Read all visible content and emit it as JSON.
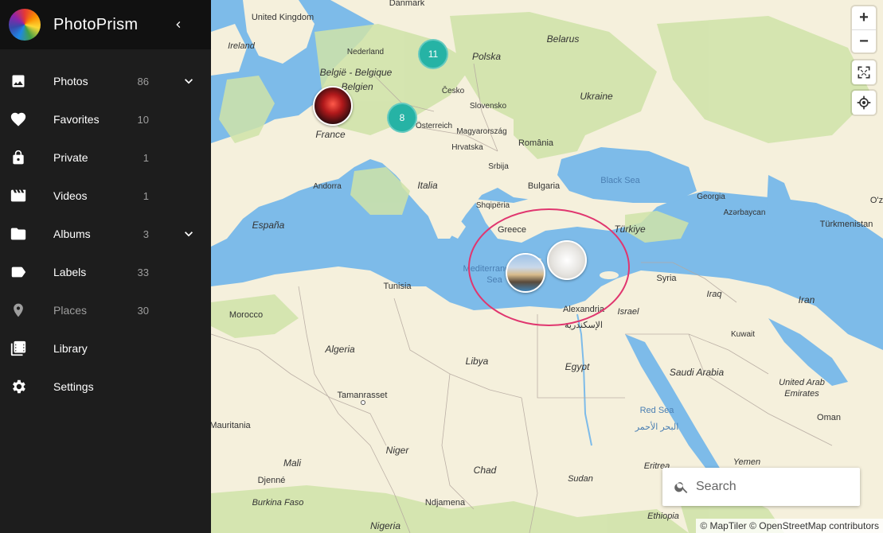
{
  "app": {
    "title": "PhotoPrism"
  },
  "sidebar": {
    "items": [
      {
        "label": "Photos",
        "count": "86"
      },
      {
        "label": "Favorites",
        "count": "10"
      },
      {
        "label": "Private",
        "count": "1"
      },
      {
        "label": "Videos",
        "count": "1"
      },
      {
        "label": "Albums",
        "count": "3"
      },
      {
        "label": "Labels",
        "count": "33"
      },
      {
        "label": "Places",
        "count": "30"
      },
      {
        "label": "Library",
        "count": ""
      },
      {
        "label": "Settings",
        "count": ""
      }
    ]
  },
  "map": {
    "labels": {
      "united_kingdom": "United Kingdom",
      "ireland": "Ireland",
      "danmark": "Danmark",
      "nederland": "Nederland",
      "belgie": "België - Belgique",
      "belgien": "- Belgien",
      "france": "France",
      "polska": "Polska",
      "belarus": "Belarus",
      "cesko": "Česko",
      "slovensko": "Slovensko",
      "osterreich": "Österreich",
      "ukraine": "Ukraine",
      "romania": "România",
      "magyarorszag": "Magyarország",
      "hrvatska": "Hrvatska",
      "srbija": "Srbija",
      "bulgaria": "Bulgaria",
      "shqiperia": "Shqipëria",
      "italia": "Italia",
      "andorra": "Andorra",
      "espana": "España",
      "black_sea": "Black Sea",
      "georgia": "Georgia",
      "azarbaycan": "Azərbaycan",
      "turkiye": "Türkiye",
      "turkmenistan": "Türkmenistan",
      "oz": "O'z",
      "ellada": "Greece",
      "mediterranean": "Mediterranean",
      "sea": "Sea",
      "syria": "Syria",
      "iraq": "Iraq",
      "iran": "Iran",
      "israel": "Israel",
      "alexandria": "Alexandria",
      "alexandria_ar": "الإسكندرية",
      "tunisia": "Tunisia",
      "morocco": "Morocco",
      "algeria": "Algeria",
      "libya": "Libya",
      "egypt": "Egypt",
      "kuwait": "Kuwait",
      "saudi_arabia": "Saudi Arabia",
      "uae": "United Arab",
      "emirates": "Emirates",
      "tamanrasset": "Tamanrasset",
      "mauritania": "Mauritania",
      "red_sea": "Red Sea",
      "red_sea_ar": "البحر الأحمر",
      "oman": "Oman",
      "mali": "Mali",
      "niger": "Niger",
      "chad": "Chad",
      "sudan": "Sudan",
      "eritrea": "Eritrea",
      "yemen": "Yemen",
      "djenne": "Djenné",
      "burkina": "Burkina Faso",
      "ndjamena": "Ndjamena",
      "nigeria": "Nigeria",
      "ethiopia": "Ethiopia"
    },
    "clusters": [
      "11",
      "8"
    ],
    "zoom_in": "+",
    "zoom_out": "−",
    "search_placeholder": "Search",
    "attribution": "© MapTiler © OpenStreetMap contributors",
    "colors": {
      "land": "#f5f0dc",
      "green": "#cfe3a8",
      "water": "#7dbbe9",
      "cluster": "#26b3a5",
      "highlight": "#e0366f"
    }
  }
}
